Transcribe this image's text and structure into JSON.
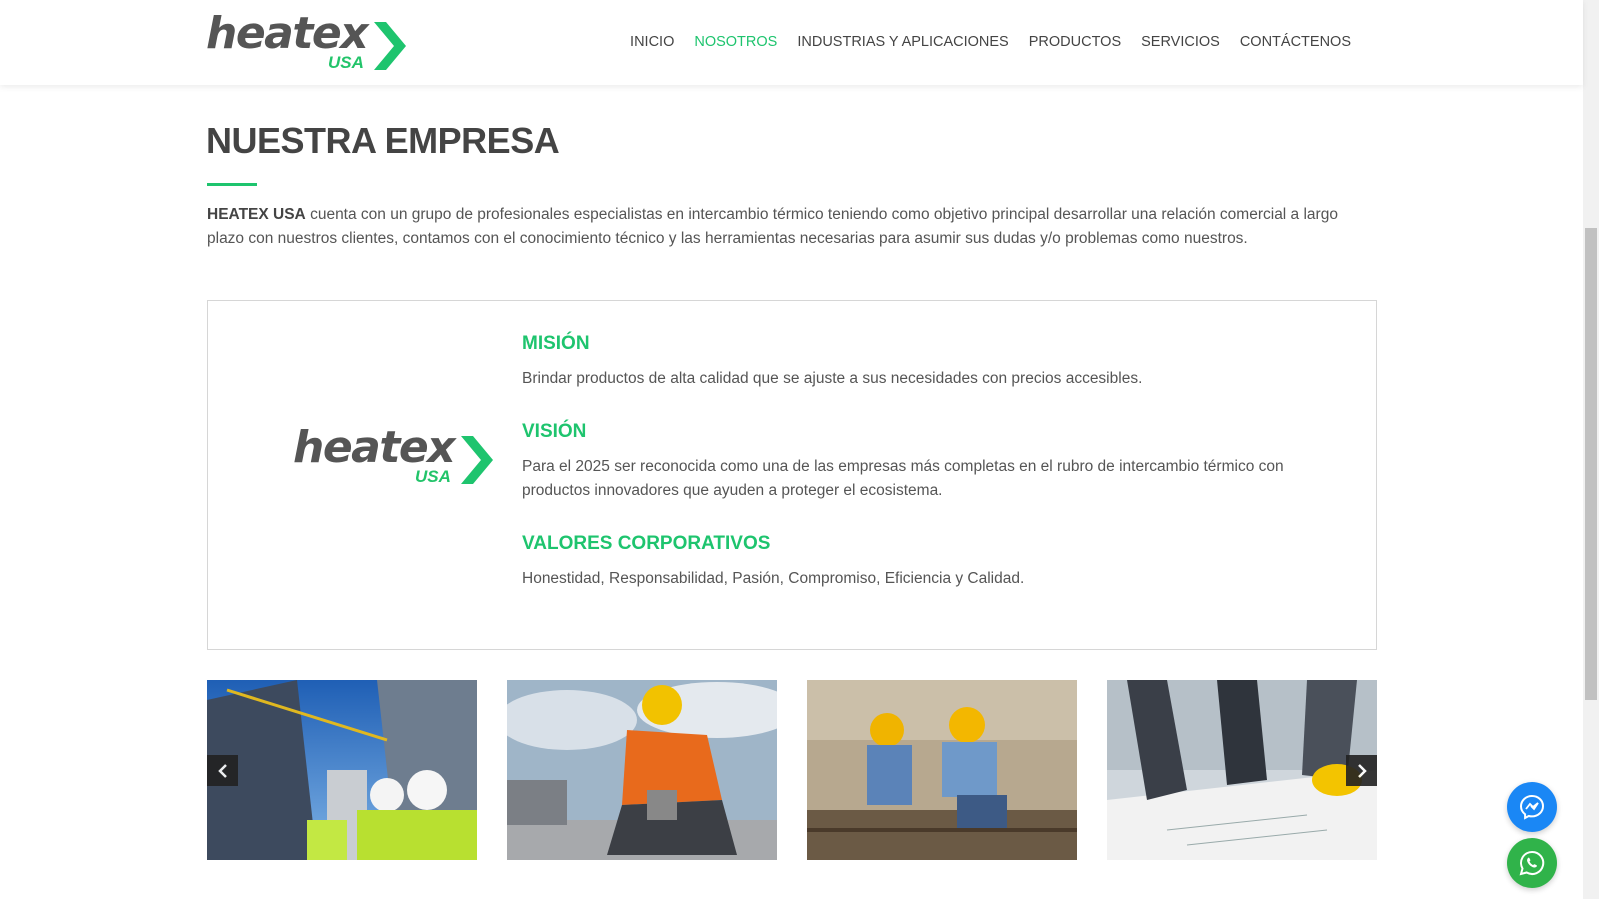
{
  "header": {
    "logo_word": "heatex",
    "logo_sub": "USA",
    "nav": [
      {
        "label": "INICIO",
        "active": false
      },
      {
        "label": "NOSOTROS",
        "active": true
      },
      {
        "label": "INDUSTRIAS Y APLICACIONES",
        "active": false
      },
      {
        "label": "PRODUCTOS",
        "active": false
      },
      {
        "label": "SERVICIOS",
        "active": false
      },
      {
        "label": "CONTÁCTENOS",
        "active": false
      }
    ]
  },
  "main": {
    "title": "NUESTRA EMPRESA",
    "intro_bold": "HEATEX USA",
    "intro_rest": " cuenta con un grupo de profesionales especialistas en intercambio térmico teniendo como objetivo principal desarrollar una relación comercial a largo plazo con nuestros clientes, contamos con el conocimiento técnico y las herramientas necesarias para asumir sus dudas y/o problemas como nuestros.",
    "box": {
      "logo_word": "heatex",
      "logo_sub": "USA",
      "mision_title": "MISIÓN",
      "mision_text": "Brindar productos de alta calidad que se ajuste a sus necesidades con precios accesibles.",
      "vision_title": "VISIÓN",
      "vision_text": "Para el 2025 ser reconocida como una de las empresas más completas en el rubro de intercambio térmico con productos innovadores que ayuden a proteger el ecosistema.",
      "valores_title": "VALORES CORPORATIVOS",
      "valores_text": "Honestidad, Responsabilidad, Pasión, Compromiso, Eficiencia y Calidad."
    }
  },
  "gallery": {
    "images": [
      "construction-site-workers-photo",
      "worker-cutting-metal-photo",
      "workers-on-scaffold-photo",
      "blueprint-planning-photo"
    ],
    "prev_icon": "chevron-left-icon",
    "next_icon": "chevron-right-icon"
  },
  "floating": {
    "messenger_color": "#1a87f5",
    "whatsapp_color": "#30b34a"
  },
  "colors": {
    "accent": "#1ec46e",
    "text": "#555555"
  }
}
